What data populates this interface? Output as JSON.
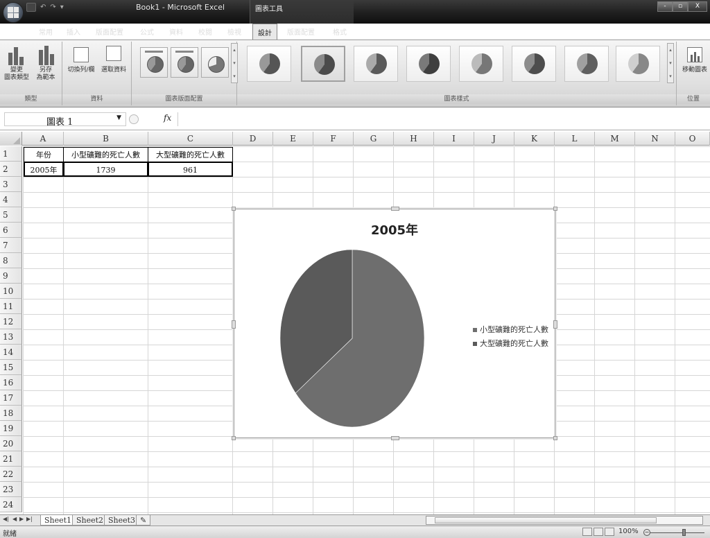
{
  "window": {
    "title": "Book1 - Microsoft Excel",
    "contextual_tab_group": "圖表工具",
    "controls": [
      "-",
      "▫",
      "X"
    ]
  },
  "tabs": {
    "items": [
      "常用",
      "插入",
      "版面配置",
      "公式",
      "資料",
      "校閱",
      "檢視",
      "設計",
      "版面配置",
      "格式"
    ],
    "active": "設計",
    "help": "◎ - ▫"
  },
  "ribbon": {
    "groups": {
      "type": {
        "label": "類型",
        "change_chart_type": "變更\n圖表類型",
        "save_as_template": "另存\n為範本"
      },
      "data": {
        "label": "資料",
        "switch_row_column": "切換列/欄",
        "select_data": "選取資料"
      },
      "chart_layouts": {
        "label": "圖表版面配置"
      },
      "chart_styles": {
        "label": "圖表樣式",
        "count": 8
      },
      "location": {
        "label": "位置",
        "move_chart": "移動圖表"
      }
    }
  },
  "formula_bar": {
    "name_box": "圖表 1",
    "fx": "fx",
    "value": ""
  },
  "sheet": {
    "columns": [
      "A",
      "B",
      "C",
      "D",
      "E",
      "F",
      "G",
      "H",
      "I",
      "J",
      "K",
      "L",
      "M",
      "N",
      "O"
    ],
    "rows": [
      "1",
      "2",
      "3",
      "4",
      "5",
      "6",
      "7",
      "8",
      "9",
      "10",
      "11",
      "12",
      "13",
      "14",
      "15",
      "16",
      "17",
      "18",
      "19",
      "20",
      "21",
      "22",
      "23",
      "24"
    ],
    "cells": {
      "A1": "年份",
      "B1": "小型礦難的死亡人數",
      "C1": "大型礦難的死亡人數",
      "A2": "2005年",
      "B2": "1739",
      "C2": "961"
    }
  },
  "chart_data": {
    "type": "pie",
    "title": "2005年",
    "categories": [
      "小型礦難的死亡人數",
      "大型礦難的死亡人數"
    ],
    "values": [
      1739,
      961
    ],
    "legend_position": "right",
    "colors": [
      "#6e6e6e",
      "#5a5a5a"
    ]
  },
  "sheet_tabs": {
    "items": [
      "Sheet1",
      "Sheet2",
      "Sheet3"
    ],
    "active": "Sheet1"
  },
  "status_bar": {
    "status": "就緒",
    "zoom": "100%"
  }
}
